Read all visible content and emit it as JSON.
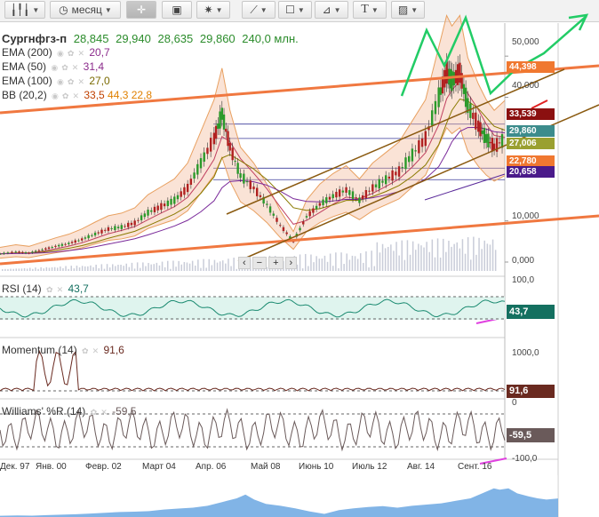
{
  "toolbar": {
    "period_label": "месяц",
    "text_tool_label": "T"
  },
  "symbol": {
    "name": "Сургнфгз-п",
    "open": "28,845",
    "high": "29,940",
    "low": "28,635",
    "close": "29,860",
    "volume": "240,0 млн."
  },
  "indicators": [
    {
      "label": "EMA (200)",
      "value": "20,7",
      "color": "#8b2b8b"
    },
    {
      "label": "EMA (50)",
      "value": "31,4",
      "color": "#8b2b8b"
    },
    {
      "label": "EMA (100)",
      "value": "27,0",
      "color": "#7a6a00"
    },
    {
      "label": "BB (20,2)",
      "value": "33,5",
      "value2": "44,3",
      "value3": "22,8",
      "color": "#c04000",
      "color2": "#e08000"
    }
  ],
  "price_axis": [
    "50,000",
    "40,000",
    "10,000",
    "0,000"
  ],
  "price_tags": [
    {
      "text": "44,398",
      "color": "#f07830"
    },
    {
      "text": "33,539",
      "color": "#8b1010"
    },
    {
      "text": "29,860",
      "color": "#3c8c8c"
    },
    {
      "text": "27,006",
      "color": "#9aa030"
    },
    {
      "text": "22,780",
      "color": "#f07830"
    },
    {
      "text": "20,658",
      "color": "#4a1a8a"
    }
  ],
  "rsi": {
    "label": "RSI (14)",
    "value": "43,7",
    "axis": [
      "100,0"
    ],
    "tag": "43,7",
    "tag_color": "#147060"
  },
  "momentum": {
    "label": "Momentum (14)",
    "value": "91,6",
    "axis": [
      "1000,0"
    ],
    "tag": "91,6",
    "tag_color": "#6a2a20"
  },
  "williams": {
    "label": "Williams' %R (14)",
    "value": "-59,5",
    "axis": [
      "0",
      "-100,0"
    ],
    "tag": "-59,5",
    "tag_color": "#6a5a5a"
  },
  "x_labels": [
    "Дек. 97",
    "Янв. 00",
    "Февр. 02",
    "Март 04",
    "Апр. 06",
    "Май 08",
    "Июнь 10",
    "Июль 12",
    "Авг. 14",
    "Сент. 16"
  ],
  "zoom_controls": [
    "‹",
    "−",
    "+",
    "›"
  ],
  "chart_data": {
    "type": "line",
    "title": "Сургнфгз-п",
    "x": [
      1997.9,
      1998.5,
      1999.0,
      1999.5,
      2000.0,
      2000.5,
      2001.0,
      2001.5,
      2002.0,
      2002.5,
      2003.0,
      2003.5,
      2004.0,
      2004.5,
      2005.0,
      2005.5,
      2006.0,
      2006.3,
      2006.6,
      2007.0,
      2007.5,
      2008.0,
      2008.5,
      2009.0,
      2009.5,
      2010.0,
      2010.5,
      2011.0,
      2011.5,
      2012.0,
      2012.5,
      2013.0,
      2013.5,
      2014.0,
      2014.5,
      2014.8,
      2015.0,
      2015.3,
      2015.6,
      2016.0,
      2016.3,
      2016.6,
      2017.0
    ],
    "series": [
      {
        "values": [
          2.0,
          2.5,
          2.2,
          3.0,
          3.8,
          4.5,
          5.5,
          6.8,
          8.0,
          8.5,
          9.5,
          12.0,
          13.5,
          15.0,
          18.0,
          24.0,
          30.0,
          36.0,
          28.0,
          21.0,
          18.0,
          14.0,
          9.0,
          5.0,
          11.0,
          14.0,
          16.0,
          17.5,
          15.0,
          18.0,
          20.0,
          22.0,
          26.0,
          30.0,
          40.0,
          46.0,
          44.0,
          46.0,
          38.0,
          33.0,
          30.0,
          28.0,
          29.86
        ]
      }
    ],
    "ylim": [
      0,
      55
    ]
  }
}
